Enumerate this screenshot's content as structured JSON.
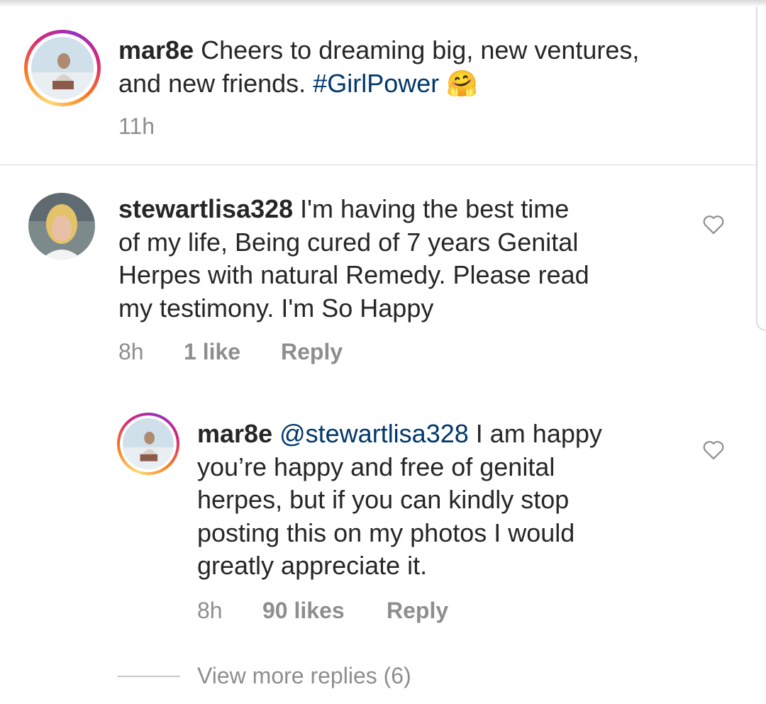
{
  "caption": {
    "username": "mar8e",
    "text": "Cheers to dreaming big, new ventures,",
    "text_line2": "and new friends.",
    "hashtag": "#GirlPower",
    "emoji": "🤗",
    "time": "11h"
  },
  "comment": {
    "username": "stewartlisa328",
    "lines": [
      " I'm having the best time",
      "of my life, Being cured of 7 years Genital",
      "Herpes with natural Remedy. Please read",
      "my testimony. I'm So Happy"
    ],
    "time": "8h",
    "likes": "1 like",
    "reply_label": "Reply"
  },
  "reply": {
    "username": "mar8e",
    "mention": "@stewartlisa328",
    "lines": [
      " I am happy",
      "you’re happy and free of genital",
      "herpes, but if you can kindly stop",
      "posting this on my photos I would",
      "greatly appreciate it."
    ],
    "time": "8h",
    "likes": "90 likes",
    "reply_label": "Reply"
  },
  "view_more_replies": "View more replies (6)",
  "icons": {
    "like": "heart-outline-icon",
    "avatar_ring": "story-ring-gradient"
  },
  "colors": {
    "text": "#262626",
    "secondary": "#8e8e8e",
    "link": "#00376b",
    "divider": "#dbdbdb"
  }
}
